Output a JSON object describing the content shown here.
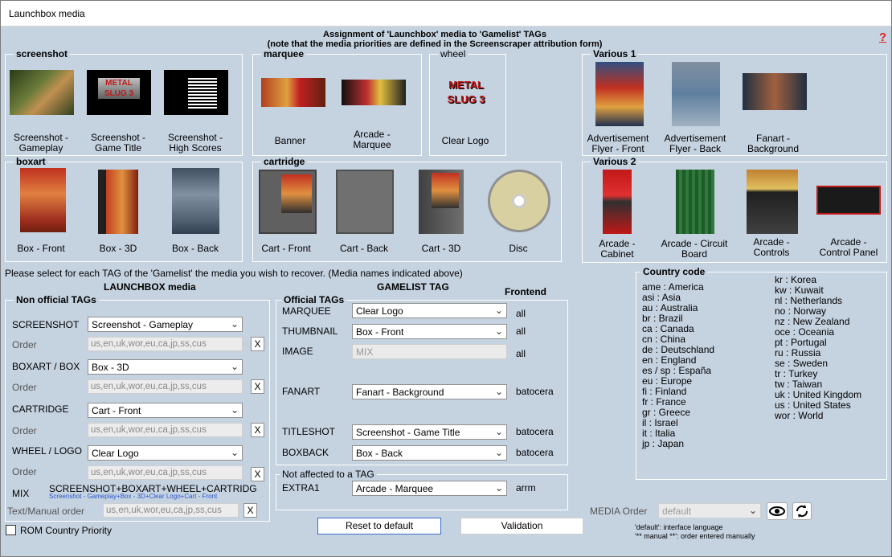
{
  "window": {
    "title": "Launchbox media"
  },
  "header": {
    "line1": "Assignment of 'Launchbox' media to 'Gamelist' TAGs",
    "line2": "(note that the media priorities are defined in the Screenscraper attribution form)",
    "help": "?"
  },
  "groups": {
    "screenshot": {
      "title": "screenshot",
      "items": [
        "Screenshot -\nGameplay",
        "Screenshot -\nGame Title",
        "Screenshot -\nHigh Scores"
      ]
    },
    "marquee": {
      "title": "marquee",
      "items": [
        "Banner",
        "Arcade -\nMarquee"
      ]
    },
    "wheel": {
      "title": "wheel",
      "items": [
        "Clear Logo"
      ]
    },
    "various1": {
      "title": "Various 1",
      "items": [
        "Advertisement\nFlyer - Front",
        "Advertisement\nFlyer - Back",
        "Fanart -\nBackground"
      ]
    },
    "boxart": {
      "title": "boxart",
      "items": [
        "Box - Front",
        "Box - 3D",
        "Box - Back"
      ]
    },
    "cartridge": {
      "title": "cartridge",
      "items": [
        "Cart - Front",
        "Cart - Back",
        "Cart - 3D",
        "Disc"
      ]
    },
    "various2": {
      "title": "Various 2",
      "items": [
        "Arcade -\nCabinet",
        "Arcade - Circuit\nBoard",
        "Arcade -\nControls",
        "Arcade -\nControl Panel"
      ]
    }
  },
  "instructions": "Please select for each TAG of the 'Gamelist' the media you wish to recover. (Media names indicated above)",
  "launchbox": {
    "heading": "LAUNCHBOX media",
    "group_title": "Non official TAGs",
    "order_label": "Order",
    "rows": [
      {
        "tag": "SCREENSHOT",
        "value": "Screenshot - Gameplay",
        "order": "us,en,uk,wor,eu,ca,jp,ss,cus",
        "x": "X"
      },
      {
        "tag": "BOXART / BOX",
        "value": "Box - 3D",
        "order": "us,en,uk,wor,eu,ca,jp,ss,cus",
        "x": "X"
      },
      {
        "tag": "CARTRIDGE",
        "value": "Cart - Front",
        "order": "us,en,uk,wor,eu,ca,jp,ss,cus",
        "x": "X"
      },
      {
        "tag": "WHEEL / LOGO",
        "value": "Clear Logo",
        "order": "us,en,uk,wor,eu,ca,jp,ss,cus",
        "x": "X"
      }
    ],
    "mix_label": "MIX",
    "mix_value": "SCREENSHOT+BOXART+WHEEL+CARTRIDG",
    "mix_sub": "Screenshot - Gameplay+Box - 3D+Clear Logo+Cart - Front",
    "manual_label": "Text/Manual order",
    "manual_value": "us,en,uk,wor,eu,ca,jp,ss,cus",
    "manual_x": "X",
    "rom_priority": "ROM Country Priority"
  },
  "gamelist": {
    "heading": "GAMELIST TAG",
    "frontend_heading": "Frontend",
    "group_title": "Official TAGs",
    "rows": [
      {
        "tag": "MARQUEE",
        "value": "Clear Logo",
        "frontend": "all"
      },
      {
        "tag": "THUMBNAIL",
        "value": "Box - Front",
        "frontend": "all"
      },
      {
        "tag": "IMAGE",
        "value": "MIX",
        "frontend": "all"
      },
      {
        "tag": "FANART",
        "value": "Fanart - Background",
        "frontend": "batocera"
      },
      {
        "tag": "TITLESHOT",
        "value": "Screenshot - Game Title",
        "frontend": "batocera"
      },
      {
        "tag": "BOXBACK",
        "value": "Box - Back",
        "frontend": "batocera"
      }
    ],
    "na_title": "Not affected to a TAG",
    "extra": {
      "tag": "EXTRA1",
      "value": "Arcade - Marquee",
      "frontend": "arrm"
    }
  },
  "buttons": {
    "reset": "Reset to default",
    "validation": "Validation"
  },
  "country": {
    "title": "Country code",
    "col1": [
      "ame : America",
      "asi : Asia",
      "au : Australia",
      "br : Brazil",
      "ca : Canada",
      "cn : China",
      "de : Deutschland",
      "en : England",
      "es / sp : España",
      "eu : Europe",
      "fi : Finland",
      "fr : France",
      "gr : Greece",
      "il : Israel",
      "it : Italia",
      "jp : Japan"
    ],
    "col2": [
      "kr : Korea",
      "kw : Kuwait",
      "nl : Netherlands",
      "no : Norway",
      "nz : New Zealand",
      "oce : Oceania",
      "pt : Portugal",
      "ru : Russia",
      "se : Sweden",
      "tr : Turkey",
      "tw : Taiwan",
      "uk : United Kingdom",
      "us : United States",
      "wor : World"
    ]
  },
  "media_order": {
    "label": "MEDIA Order",
    "value": "default",
    "note1": "'default': interface language",
    "note2": "'** manual **': order entered manually"
  }
}
